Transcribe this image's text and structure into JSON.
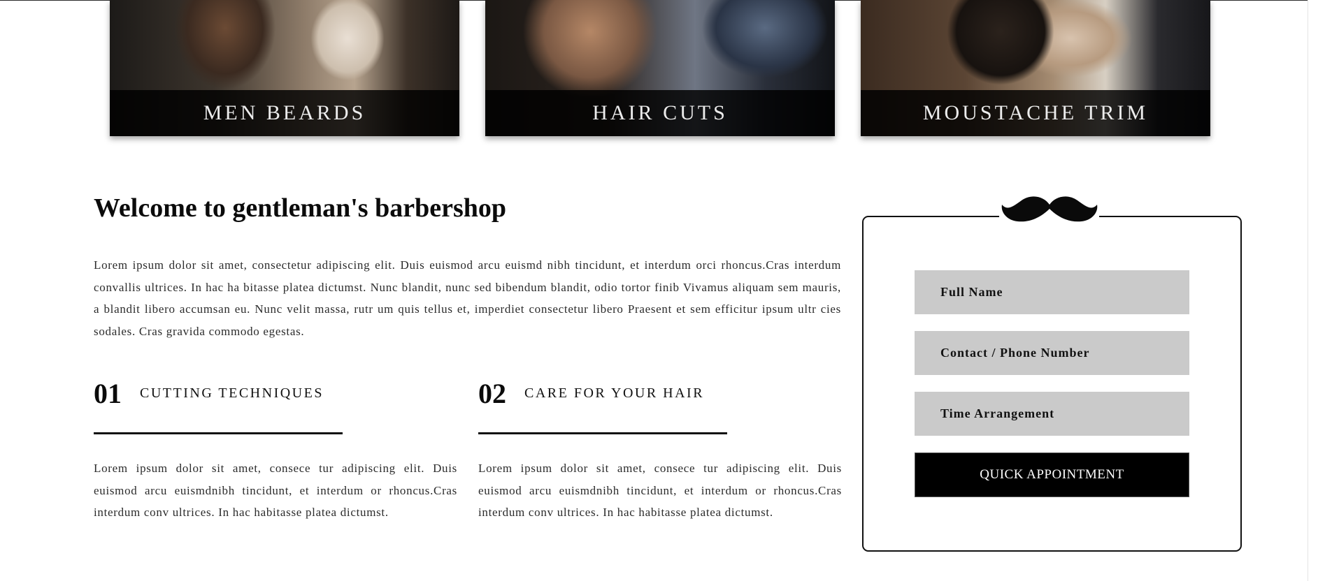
{
  "services": [
    {
      "label": "MEN BEARDS"
    },
    {
      "label": "HAIR CUTS"
    },
    {
      "label": "MOUSTACHE TRIM"
    }
  ],
  "welcome": {
    "title": "Welcome to gentleman's barbershop",
    "text": "Lorem ipsum dolor sit amet, consectetur adipiscing elit. Duis euismod arcu euismd nibh tincidunt, et interdum orci rhoncus.Cras interdum convallis ultrices. In hac ha bitasse platea dictumst. Nunc blandit, nunc sed bibendum blandit, odio tortor finib Vivamus aliquam sem mauris, a blandit libero accumsan eu. Nunc velit massa, rutr um quis tellus et, imperdiet consectetur libero Praesent et sem efficitur ipsum ultr cies sodales. Cras gravida commodo egestas."
  },
  "features": [
    {
      "number": "01",
      "title": "CUTTING TECHNIQUES",
      "text": "Lorem ipsum dolor sit amet, consece tur adipiscing elit. Duis euismod arcu euismdnibh tincidunt, et interdum or rhoncus.Cras interdum conv ultrices. In hac habitasse platea dictumst."
    },
    {
      "number": "02",
      "title": "CARE FOR YOUR HAIR",
      "text": "Lorem ipsum dolor sit amet, consece tur adipiscing elit. Duis euismod arcu euismdnibh tincidunt, et interdum or rhoncus.Cras interdum conv ultrices. In hac habitasse platea dictumst."
    }
  ],
  "appointment": {
    "icon": "moustache-icon",
    "full_name_placeholder": "Full Name",
    "phone_placeholder": "Contact / Phone Number",
    "time_placeholder": "Time Arrangement",
    "button_label": "QUICK APPOINTMENT"
  },
  "colors": {
    "field_bg": "#cacaca",
    "button_bg": "#000000",
    "caption_bg": "#000000"
  }
}
